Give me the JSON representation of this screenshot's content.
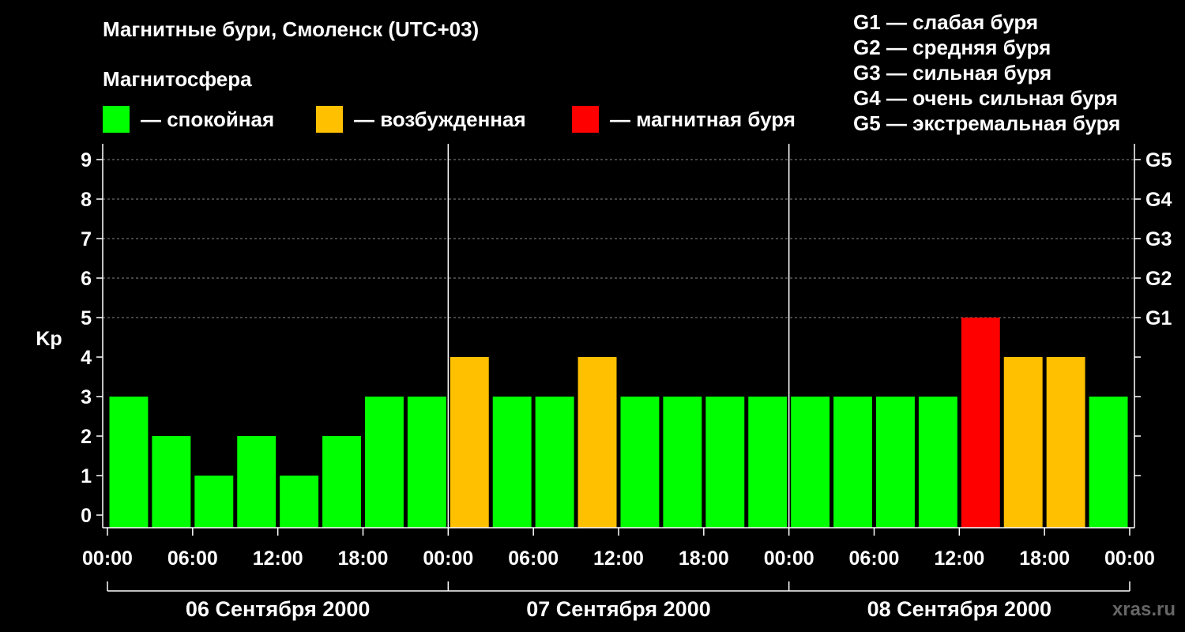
{
  "title": "Магнитные бури, Смоленск (UTC+03)",
  "subtitle": "Магнитосфера",
  "legend": [
    {
      "label": "— спокойная",
      "color": "#00ff00"
    },
    {
      "label": "— возбужденная",
      "color": "#ffc000"
    },
    {
      "label": "— магнитная буря",
      "color": "#ff0000"
    }
  ],
  "g_legend": [
    "G1 — слабая буря",
    "G2 — средняя буря",
    "G3 — сильная буря",
    "G4 — очень сильная буря",
    "G5 — экстремальная буря"
  ],
  "watermark": "xras.ru",
  "chart_data": {
    "type": "bar",
    "ylabel": "Kp",
    "ylim": [
      0,
      9
    ],
    "yticks": [
      "0",
      "1",
      "2",
      "3",
      "4",
      "5",
      "6",
      "7",
      "8",
      "9"
    ],
    "right_axis_labels": [
      {
        "kp": 5,
        "label": "G1"
      },
      {
        "kp": 6,
        "label": "G2"
      },
      {
        "kp": 7,
        "label": "G3"
      },
      {
        "kp": 8,
        "label": "G4"
      },
      {
        "kp": 9,
        "label": "G5"
      }
    ],
    "xtick_labels": [
      "00:00",
      "06:00",
      "12:00",
      "18:00",
      "00:00",
      "06:00",
      "12:00",
      "18:00",
      "00:00",
      "06:00",
      "12:00",
      "18:00",
      "00:00"
    ],
    "days": [
      "06 Сентября 2000",
      "07 Сентября 2000",
      "08 Сентября 2000"
    ],
    "grid": true,
    "values": [
      3,
      2,
      1,
      2,
      1,
      2,
      3,
      3,
      4,
      3,
      3,
      4,
      3,
      3,
      3,
      3,
      3,
      3,
      3,
      3,
      5,
      4,
      4,
      3
    ],
    "colors": {
      "quiet": "#00ff00",
      "active": "#ffc000",
      "storm": "#ff0000"
    }
  }
}
